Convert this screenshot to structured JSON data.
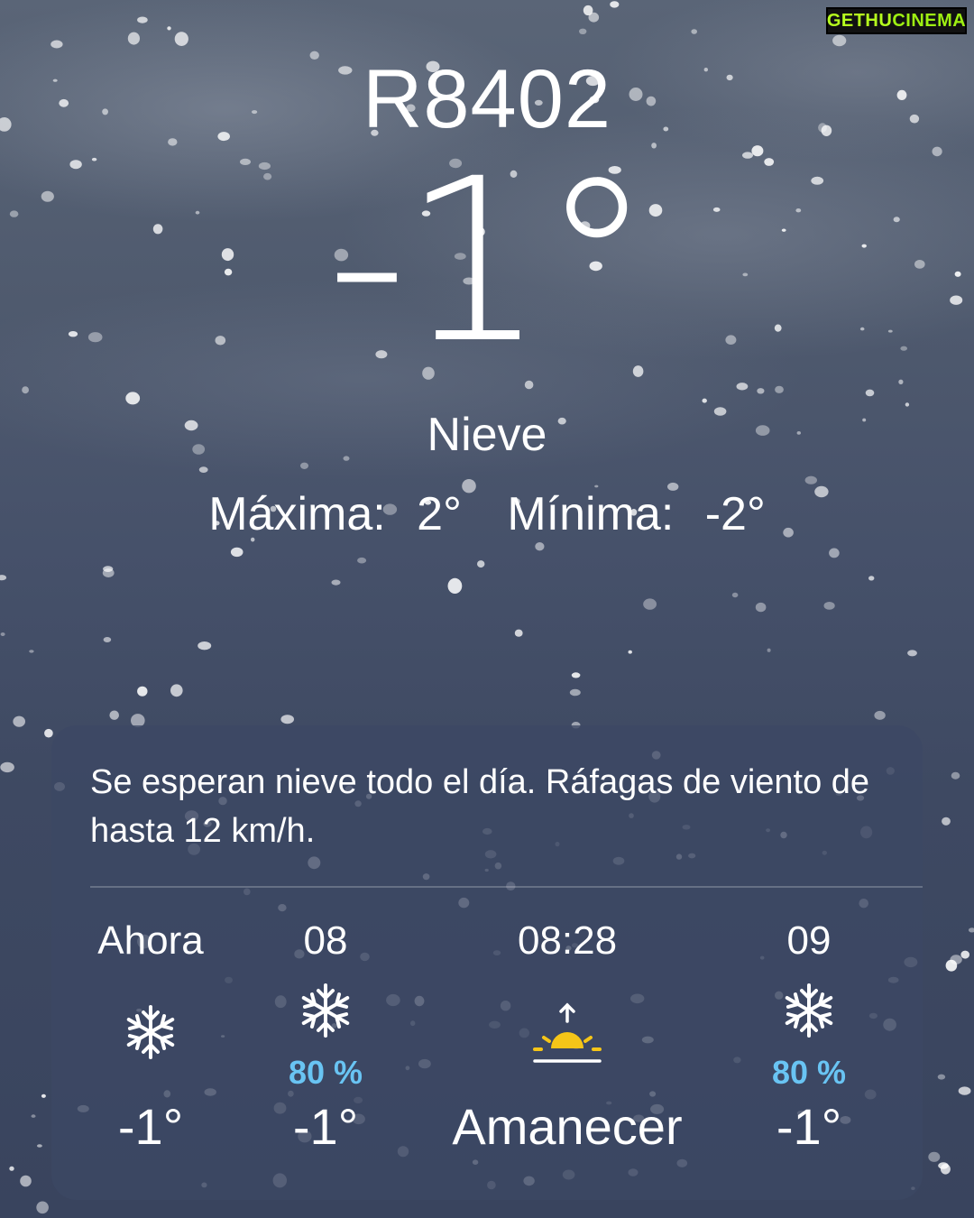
{
  "location": {
    "name": "R8402"
  },
  "current": {
    "temperature": "-1°",
    "condition": "Nieve",
    "high_label": "Máxima:",
    "high_value": "2°",
    "low_label": "Mínima:",
    "low_value": "-2°"
  },
  "forecast_card": {
    "summary": "Se esperan nieve todo el día. Ráfagas de viento de hasta 12 km/h.",
    "hours": [
      {
        "label": "Ahora",
        "icon": "snowflake-icon",
        "precip": "",
        "temp": "-1°"
      },
      {
        "label": "08",
        "icon": "snowflake-icon",
        "precip": "80 %",
        "temp": "-1°"
      },
      {
        "label": "08:28",
        "icon": "sunrise-icon",
        "precip": "",
        "temp": "Amanecer"
      },
      {
        "label": "09",
        "icon": "snowflake-icon",
        "precip": "80 %",
        "temp": "-1°"
      }
    ]
  },
  "watermark": {
    "part1": "GETHU",
    "part2": "CINEMA"
  },
  "colors": {
    "precip": "#69c4f3",
    "sun": "#f5c518",
    "background_top": "#5a6577",
    "background_bottom": "#39445e",
    "watermark": "#b6ff1e"
  }
}
